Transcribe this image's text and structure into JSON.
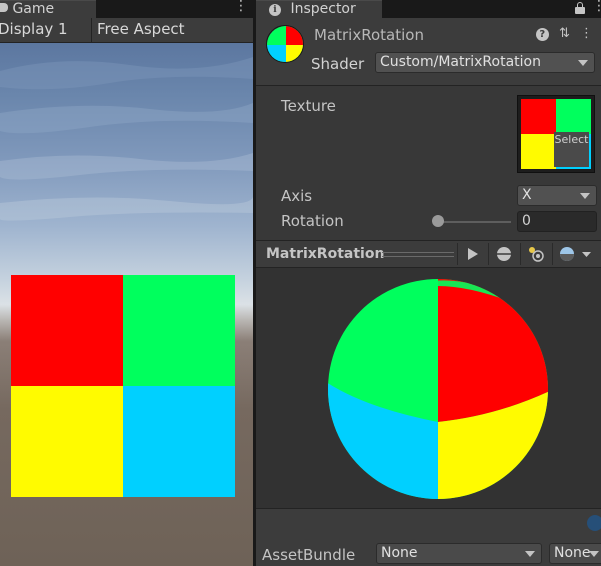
{
  "game": {
    "tab_label": "Game",
    "menu_dots": "⋮",
    "display_label": "Display 1",
    "aspect_label": "Free Aspect",
    "quad_colors": [
      "#ff0000",
      "#00ff5d",
      "#fffb00",
      "#00d0ff"
    ]
  },
  "inspector": {
    "tab_label": "Inspector",
    "info_glyph": "i",
    "material_name": "MatrixRotation",
    "help_glyph": "?",
    "settings_glyph": "⇅",
    "more_glyph": "⋮",
    "shader_label": "Shader",
    "shader_value": "Custom/MatrixRotation",
    "texture_label": "Texture",
    "texture_select": "Select",
    "axis_label": "Axis",
    "axis_value": "X",
    "rotation_label": "Rotation",
    "rotation_value": 0,
    "rotation_display": "0",
    "preview_title": "MatrixRotation",
    "assetbundle_label": "AssetBundle",
    "assetbundle_name": "None",
    "assetbundle_variant": "None"
  }
}
